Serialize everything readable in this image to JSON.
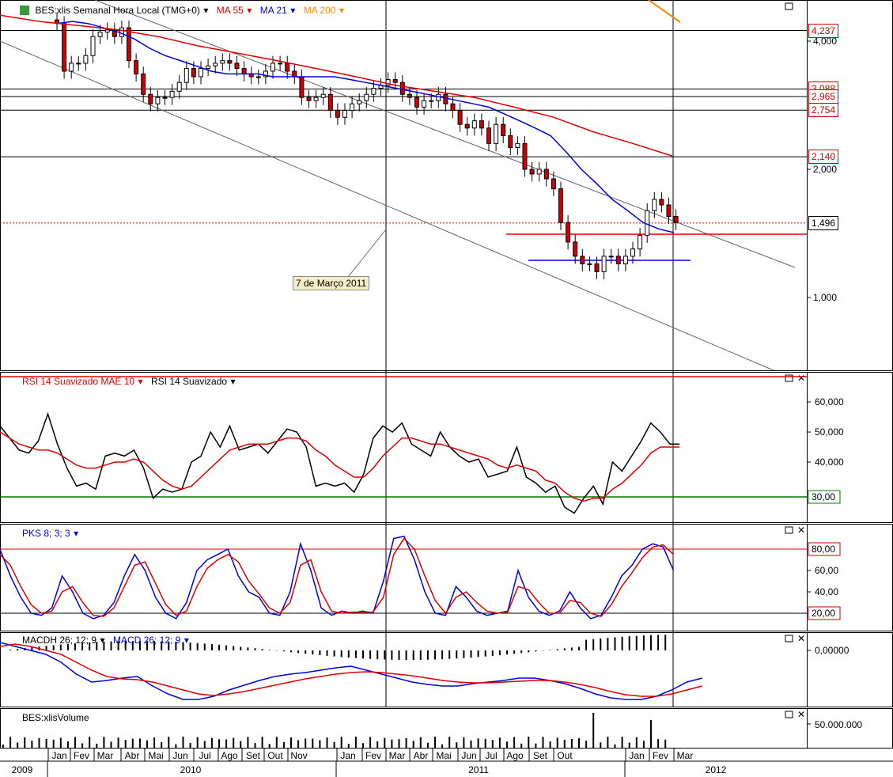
{
  "panels": {
    "price": {
      "title": "BES:xlis Semanal Hora Local (TMG+0)",
      "ma55": "MA 55",
      "ma21": "MA 21",
      "ma200": "MA 200",
      "axis_ticks": [
        "4,000",
        "2,000",
        "1,000"
      ],
      "levels": [
        {
          "value": "4,237",
          "color": "#cc0000"
        },
        {
          "value": "3,088",
          "color": "#cc0000"
        },
        {
          "value": "2,965",
          "color": "#cc0000"
        },
        {
          "value": "2,754",
          "color": "#cc0000"
        },
        {
          "value": "2,140",
          "color": "#cc0000"
        },
        {
          "value": "1,496",
          "color": "#000000"
        }
      ],
      "annotation": "7 de Março 2011"
    },
    "rsi": {
      "title_red": "RSI 14 Suavizado MAE 10",
      "title_black": "RSI 14 Suavizado",
      "axis_ticks": [
        "60,000",
        "50,000",
        "40,000",
        "30,00"
      ]
    },
    "pks": {
      "title": "PKS 8; 3; 3",
      "axis_ticks": [
        "80,00",
        "60,00",
        "40,00",
        "20,00"
      ]
    },
    "macd": {
      "title_black": "MACDH 26; 12; 9",
      "title_blue": "MACD 26; 12; 9",
      "axis_ticks": [
        "0,00000"
      ]
    },
    "volume": {
      "title": "BES:xlisVolume",
      "axis_ticks": [
        "50.000.000"
      ]
    }
  },
  "time_axis": {
    "months": [
      "Jan",
      "Fev",
      "Mar",
      "Abr",
      "Mai",
      "Jun",
      "Jul",
      "Ago",
      "Set",
      "Out",
      "Nov",
      "Jan",
      "Fev",
      "Mar",
      "Abr",
      "Mai",
      "Jun",
      "Jul",
      "Ago",
      "Set",
      "Out",
      "Jan",
      "Fev",
      "Mar"
    ],
    "years": [
      "2009",
      "2010",
      "2011",
      "2012"
    ]
  },
  "colors": {
    "ma55": "#dd0000",
    "ma21": "#0000dd",
    "ma200": "#ff8800",
    "up": "#ffffff",
    "down": "#cc0000"
  },
  "chart_data": {
    "type": "line",
    "price_closes": [
      4.4,
      3.4,
      3.55,
      3.55,
      3.7,
      4.1,
      4.2,
      4.25,
      4.1,
      4.3,
      3.6,
      3.35,
      3.0,
      2.85,
      2.95,
      2.95,
      3.05,
      3.2,
      3.45,
      3.3,
      3.45,
      3.5,
      3.55,
      3.6,
      3.55,
      3.45,
      3.35,
      3.3,
      3.3,
      3.4,
      3.55,
      3.55,
      3.4,
      3.3,
      2.95,
      2.9,
      2.95,
      3.0,
      2.75,
      2.65,
      2.75,
      2.85,
      2.9,
      3.0,
      3.1,
      3.15,
      3.25,
      3.2,
      3.0,
      2.95,
      2.8,
      2.9,
      2.9,
      3.0,
      2.85,
      2.75,
      2.55,
      2.5,
      2.6,
      2.5,
      2.3,
      2.55,
      2.4,
      2.25,
      2.3,
      2.0,
      1.95,
      2.0,
      1.9,
      1.8,
      1.5,
      1.35,
      1.25,
      1.2,
      1.2,
      1.15,
      1.25,
      1.25,
      1.2,
      1.25,
      1.3,
      1.4,
      1.6,
      1.7,
      1.65,
      1.55,
      1.5
    ],
    "ma21_values": [
      4.4,
      4.45,
      4.4,
      4.3,
      4.2,
      4.05,
      3.85,
      3.7,
      3.6,
      3.5,
      3.4,
      3.35,
      3.35,
      3.35,
      3.3,
      3.3,
      3.3,
      3.3,
      3.3,
      3.25,
      3.2,
      3.15,
      3.1,
      3.05,
      3.0,
      2.95,
      2.9,
      2.85,
      2.8,
      2.7,
      2.6,
      2.5,
      2.4,
      2.2,
      2.0,
      1.85,
      1.7,
      1.6,
      1.5,
      1.45,
      1.42
    ],
    "ma55_values": [
      4.6,
      4.45,
      4.35,
      4.25,
      4.1,
      3.9,
      3.75,
      3.6,
      3.45,
      3.3,
      3.15,
      3.05,
      2.95,
      2.8,
      2.65,
      2.45,
      2.3,
      2.15
    ],
    "rsi_range": [
      25,
      65
    ],
    "pks_range": [
      0,
      100
    ],
    "legend": "top-left"
  }
}
